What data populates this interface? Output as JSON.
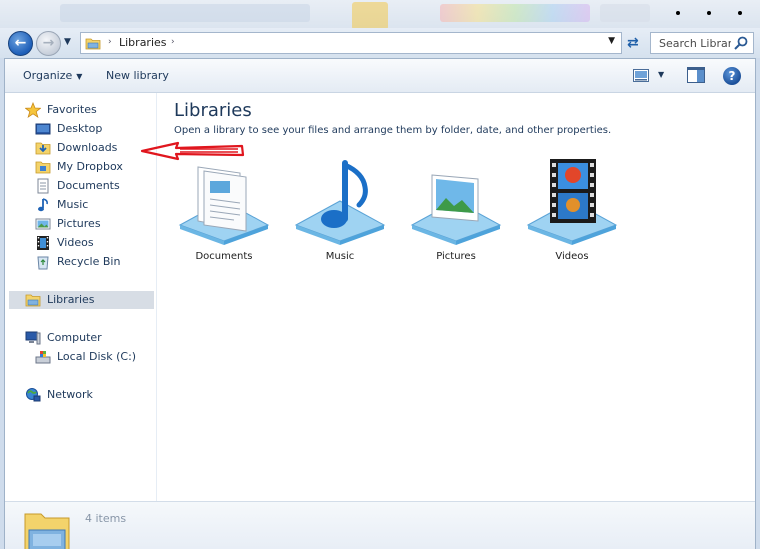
{
  "window": {
    "breadcrumb": "Libraries",
    "search_placeholder": "Search Libraries"
  },
  "toolbar": {
    "organize_label": "Organize",
    "new_library_label": "New library"
  },
  "nav": {
    "favorites_label": "Favorites",
    "favorites": [
      {
        "label": "Desktop",
        "icon": "desktop-icon"
      },
      {
        "label": "Downloads",
        "icon": "downloads-folder-icon"
      },
      {
        "label": "My Dropbox",
        "icon": "dropbox-folder-icon"
      },
      {
        "label": "Documents",
        "icon": "documents-icon"
      },
      {
        "label": "Music",
        "icon": "music-note-icon"
      },
      {
        "label": "Pictures",
        "icon": "pictures-icon"
      },
      {
        "label": "Videos",
        "icon": "film-icon"
      },
      {
        "label": "Recycle Bin",
        "icon": "recycle-bin-icon"
      }
    ],
    "libraries_label": "Libraries",
    "computer_label": "Computer",
    "local_disk_label": "Local Disk (C:)",
    "network_label": "Network"
  },
  "content": {
    "title": "Libraries",
    "subtitle": "Open a library to see your files and arrange them by folder, date, and other properties.",
    "libraries": [
      {
        "label": "Documents",
        "icon": "documents-library-icon"
      },
      {
        "label": "Music",
        "icon": "music-library-icon"
      },
      {
        "label": "Pictures",
        "icon": "pictures-library-icon"
      },
      {
        "label": "Videos",
        "icon": "videos-library-icon"
      }
    ]
  },
  "details": {
    "item_count": "4 items"
  },
  "colors": {
    "accent": "#1e395b",
    "selection": "#d7dde5",
    "annotation": "#e0161e"
  }
}
